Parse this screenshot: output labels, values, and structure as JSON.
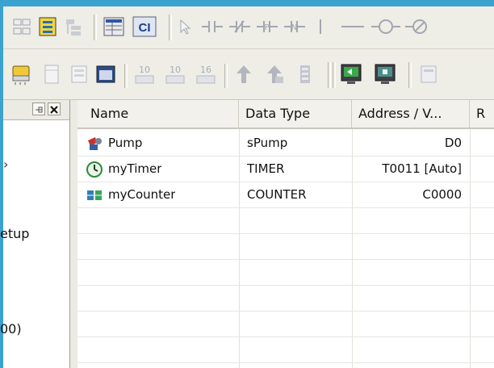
{
  "left_pane": {
    "items": [
      {
        "label": "etup"
      },
      {
        "label": "00)"
      }
    ]
  },
  "table": {
    "columns": [
      "Name",
      "Data Type",
      "Address / V...",
      "R"
    ],
    "rows": [
      {
        "icon": "pump-icon",
        "name": "Pump",
        "type": "sPump",
        "address": "D0"
      },
      {
        "icon": "timer-icon",
        "name": "myTimer",
        "type": "TIMER",
        "address": "T0011 [Auto]"
      },
      {
        "icon": "counter-icon",
        "name": "myCounter",
        "type": "COUNTER",
        "address": "C0000"
      }
    ]
  },
  "toolbar": {
    "row1": [
      "network-icon",
      "block-icon",
      "tree-icon",
      "symbol-table-icon",
      "ci-icon",
      "select-icon",
      "contact-no-icon",
      "contact-nc-icon",
      "contact-pos-icon",
      "contact-neg-icon",
      "branch-icon",
      "line-icon",
      "coil-icon",
      "coil-neg-icon"
    ],
    "ci_label": "CI",
    "row2": [
      "transfer-icon",
      "page-icon",
      "page-blank-icon",
      "monitor-icon",
      "counter-10-icon",
      "counter-10b-icon",
      "counter-16-icon",
      "upload-icon",
      "download-icon",
      "compile-icon",
      "online-icon",
      "offline-icon",
      "extra-icon"
    ]
  }
}
